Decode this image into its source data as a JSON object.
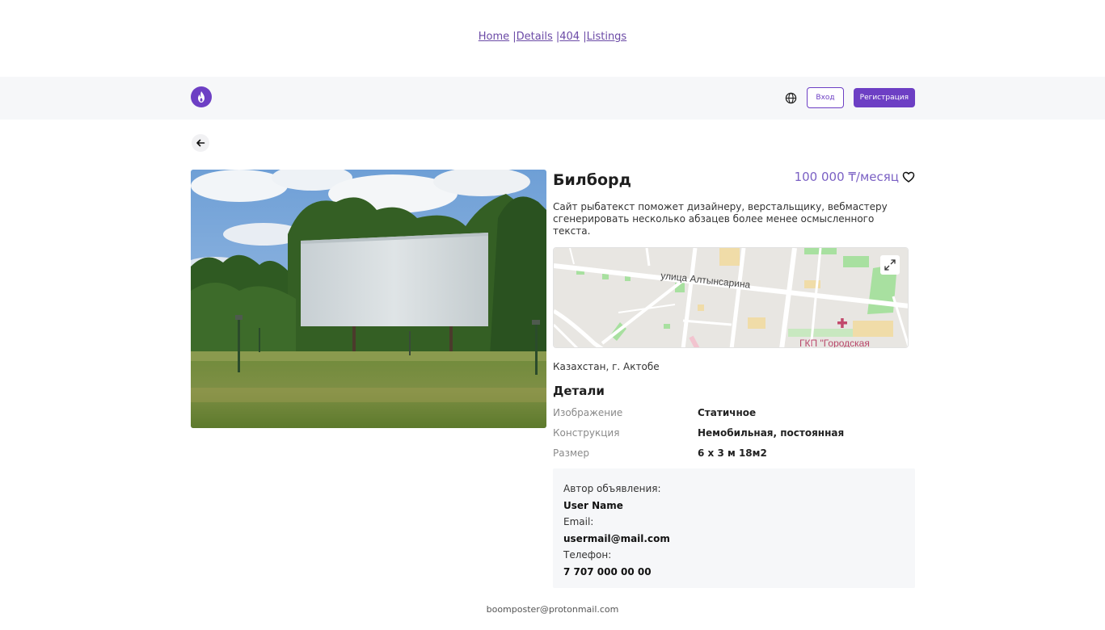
{
  "topnav": {
    "items": [
      "Home",
      "Details",
      "404",
      "Listings"
    ]
  },
  "header": {
    "login_label": "Вход",
    "register_label": "Регистрация"
  },
  "listing": {
    "title": "Билборд",
    "price": "100 000 ₸/месяц",
    "description": "Сайт рыбатекст поможет дизайнеру, верстальщику, вебмастеру сгенерировать несколько абзацев более менее осмысленного текста.",
    "map": {
      "street_label": "улица Алтынсарина",
      "poi_label": "ГКП \"Городская"
    },
    "location": "Казахстан, г. Актобе"
  },
  "details": {
    "title": "Детали",
    "rows": [
      {
        "label": "Изображение",
        "value": "Статичное"
      },
      {
        "label": "Конструкция",
        "value": "Немобильная, постоянная"
      },
      {
        "label": "Размер",
        "value": "6 x 3 м 18м2"
      }
    ]
  },
  "author": {
    "author_label": "Автор объявления:",
    "author_name": "User Name",
    "email_label": "Email:",
    "email": "usermail@mail.com",
    "phone_label": "Телефон:",
    "phone": "7 707 000 00 00"
  },
  "footer": {
    "email": "boomposter@protonmail.com"
  },
  "colors": {
    "accent": "#6d3fc4",
    "price": "#7b61c4",
    "header_bg": "#f6f7f9"
  }
}
